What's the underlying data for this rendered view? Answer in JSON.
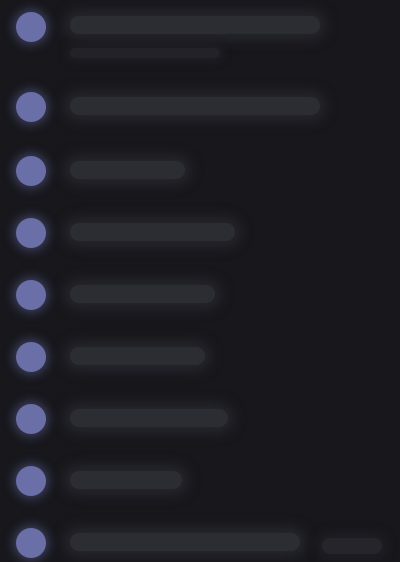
{
  "list": {
    "items": [
      {
        "label": "",
        "sublabel": ""
      },
      {
        "label": ""
      },
      {
        "label": ""
      },
      {
        "label": ""
      },
      {
        "label": ""
      },
      {
        "label": ""
      },
      {
        "label": ""
      },
      {
        "label": ""
      },
      {
        "label": "",
        "trailing": ""
      }
    ]
  },
  "colors": {
    "background": "#17171c",
    "bullet": "#6b6fa8",
    "placeholder_text": "#2c2c33"
  },
  "icons": {
    "bullet": "avatar-icon"
  }
}
